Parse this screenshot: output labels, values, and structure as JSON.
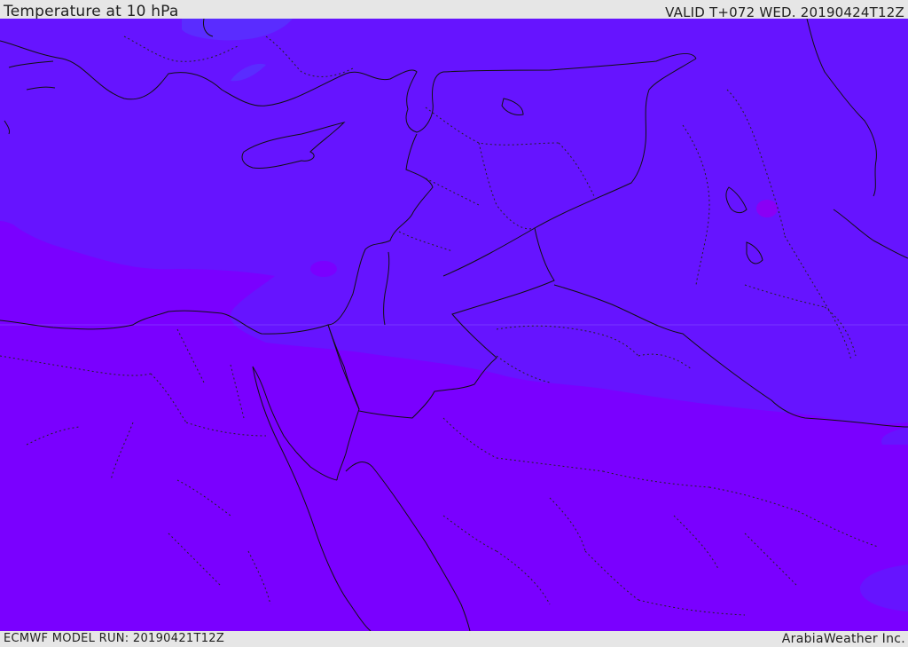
{
  "header": {
    "title": "Temperature at 10 hPa",
    "valid": "VALID T+072 WED. 20190424T12Z"
  },
  "footer": {
    "model_run": "ECMWF MODEL RUN: 20190421T12Z",
    "credit": "ArabiaWeather Inc."
  },
  "map": {
    "field": "temperature",
    "level": "10 hPa",
    "colors": {
      "cold_band": "#6614ff",
      "warm_band": "#7a00ff",
      "patch_blue": "#5a2cff",
      "patch_magenta": "#8a00f5",
      "border": "#111111"
    }
  }
}
